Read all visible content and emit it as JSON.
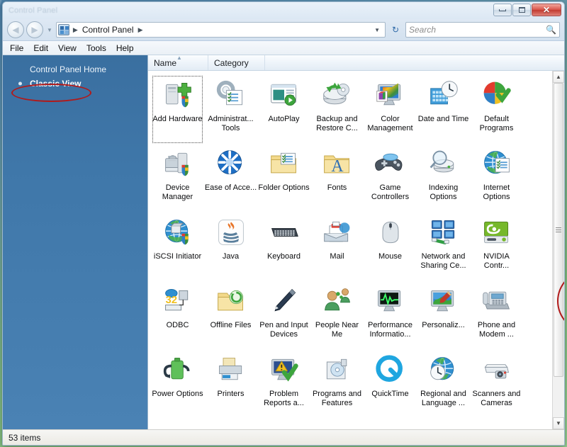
{
  "desktop": {
    "wallpaper": "vista-aurora-blue-green"
  },
  "window": {
    "title": "Control Panel",
    "buttons": {
      "minimize": "Minimize",
      "maximize": "Maximize",
      "close": "Close"
    }
  },
  "navigation": {
    "back": "Back",
    "forward": "Forward",
    "recent_pages": "Recent Pages",
    "breadcrumb": [
      "Control Panel"
    ],
    "address_dropdown": "Previous Locations",
    "refresh": "Refresh"
  },
  "search": {
    "placeholder": "Search",
    "value": ""
  },
  "menubar": [
    "File",
    "Edit",
    "View",
    "Tools",
    "Help"
  ],
  "sidebar": {
    "items": [
      {
        "label": "Control Panel Home",
        "selected": false
      },
      {
        "label": "Classic View",
        "selected": true
      }
    ],
    "annotation_color": "#b11a1a"
  },
  "columns": [
    {
      "label": "Name",
      "sorted": "asc"
    },
    {
      "label": "Category",
      "sorted": ""
    }
  ],
  "items": [
    {
      "label": "Add Hardware",
      "icon": "add-hardware-icon",
      "focused": true
    },
    {
      "label": "Administrat... Tools",
      "icon": "administrative-tools-icon",
      "focused": false
    },
    {
      "label": "AutoPlay",
      "icon": "autoplay-icon",
      "focused": false
    },
    {
      "label": "Backup and Restore C...",
      "icon": "backup-restore-icon",
      "focused": false
    },
    {
      "label": "Color Management",
      "icon": "color-management-icon",
      "focused": false
    },
    {
      "label": "Date and Time",
      "icon": "date-and-time-icon",
      "focused": false
    },
    {
      "label": "Default Programs",
      "icon": "default-programs-icon",
      "focused": false
    },
    {
      "label": "Device Manager",
      "icon": "device-manager-icon",
      "focused": false
    },
    {
      "label": "Ease of Acce...",
      "icon": "ease-of-access-icon",
      "focused": false
    },
    {
      "label": "Folder Options",
      "icon": "folder-options-icon",
      "focused": false
    },
    {
      "label": "Fonts",
      "icon": "fonts-icon",
      "focused": false
    },
    {
      "label": "Game Controllers",
      "icon": "game-controllers-icon",
      "focused": false
    },
    {
      "label": "Indexing Options",
      "icon": "indexing-options-icon",
      "focused": false
    },
    {
      "label": "Internet Options",
      "icon": "internet-options-icon",
      "focused": false
    },
    {
      "label": "iSCSI Initiator",
      "icon": "iscsi-initiator-icon",
      "focused": false
    },
    {
      "label": "Java",
      "icon": "java-icon",
      "focused": false
    },
    {
      "label": "Keyboard",
      "icon": "keyboard-icon",
      "focused": false
    },
    {
      "label": "Mail",
      "icon": "mail-icon",
      "focused": false
    },
    {
      "label": "Mouse",
      "icon": "mouse-icon",
      "focused": false
    },
    {
      "label": "Network and Sharing Ce...",
      "icon": "network-sharing-center-icon",
      "focused": false,
      "annotated": true
    },
    {
      "label": "NVIDIA Contr...",
      "icon": "nvidia-control-panel-icon",
      "focused": false
    },
    {
      "label": "ODBC",
      "icon": "odbc-icon",
      "focused": false
    },
    {
      "label": "Offline Files",
      "icon": "offline-files-icon",
      "focused": false
    },
    {
      "label": "Pen and Input Devices",
      "icon": "pen-input-devices-icon",
      "focused": false
    },
    {
      "label": "People Near Me",
      "icon": "people-near-me-icon",
      "focused": false
    },
    {
      "label": "Performance Informatio...",
      "icon": "performance-information-icon",
      "focused": false
    },
    {
      "label": "Personaliz...",
      "icon": "personalization-icon",
      "focused": false
    },
    {
      "label": "Phone and Modem ...",
      "icon": "phone-and-modem-icon",
      "focused": false
    },
    {
      "label": "Power Options",
      "icon": "power-options-icon",
      "focused": false
    },
    {
      "label": "Printers",
      "icon": "printers-icon",
      "focused": false
    },
    {
      "label": "Problem Reports a...",
      "icon": "problem-reports-icon",
      "focused": false
    },
    {
      "label": "Programs and Features",
      "icon": "programs-and-features-icon",
      "focused": false
    },
    {
      "label": "QuickTime",
      "icon": "quicktime-icon",
      "focused": false
    },
    {
      "label": "Regional and Language ...",
      "icon": "regional-language-icon",
      "focused": false
    },
    {
      "label": "Scanners and Cameras",
      "icon": "scanners-and-cameras-icon",
      "focused": false
    }
  ],
  "scrollbar": {
    "up": "Scroll Up",
    "down": "Scroll Down"
  },
  "statusbar": {
    "item_count": "53 items"
  }
}
